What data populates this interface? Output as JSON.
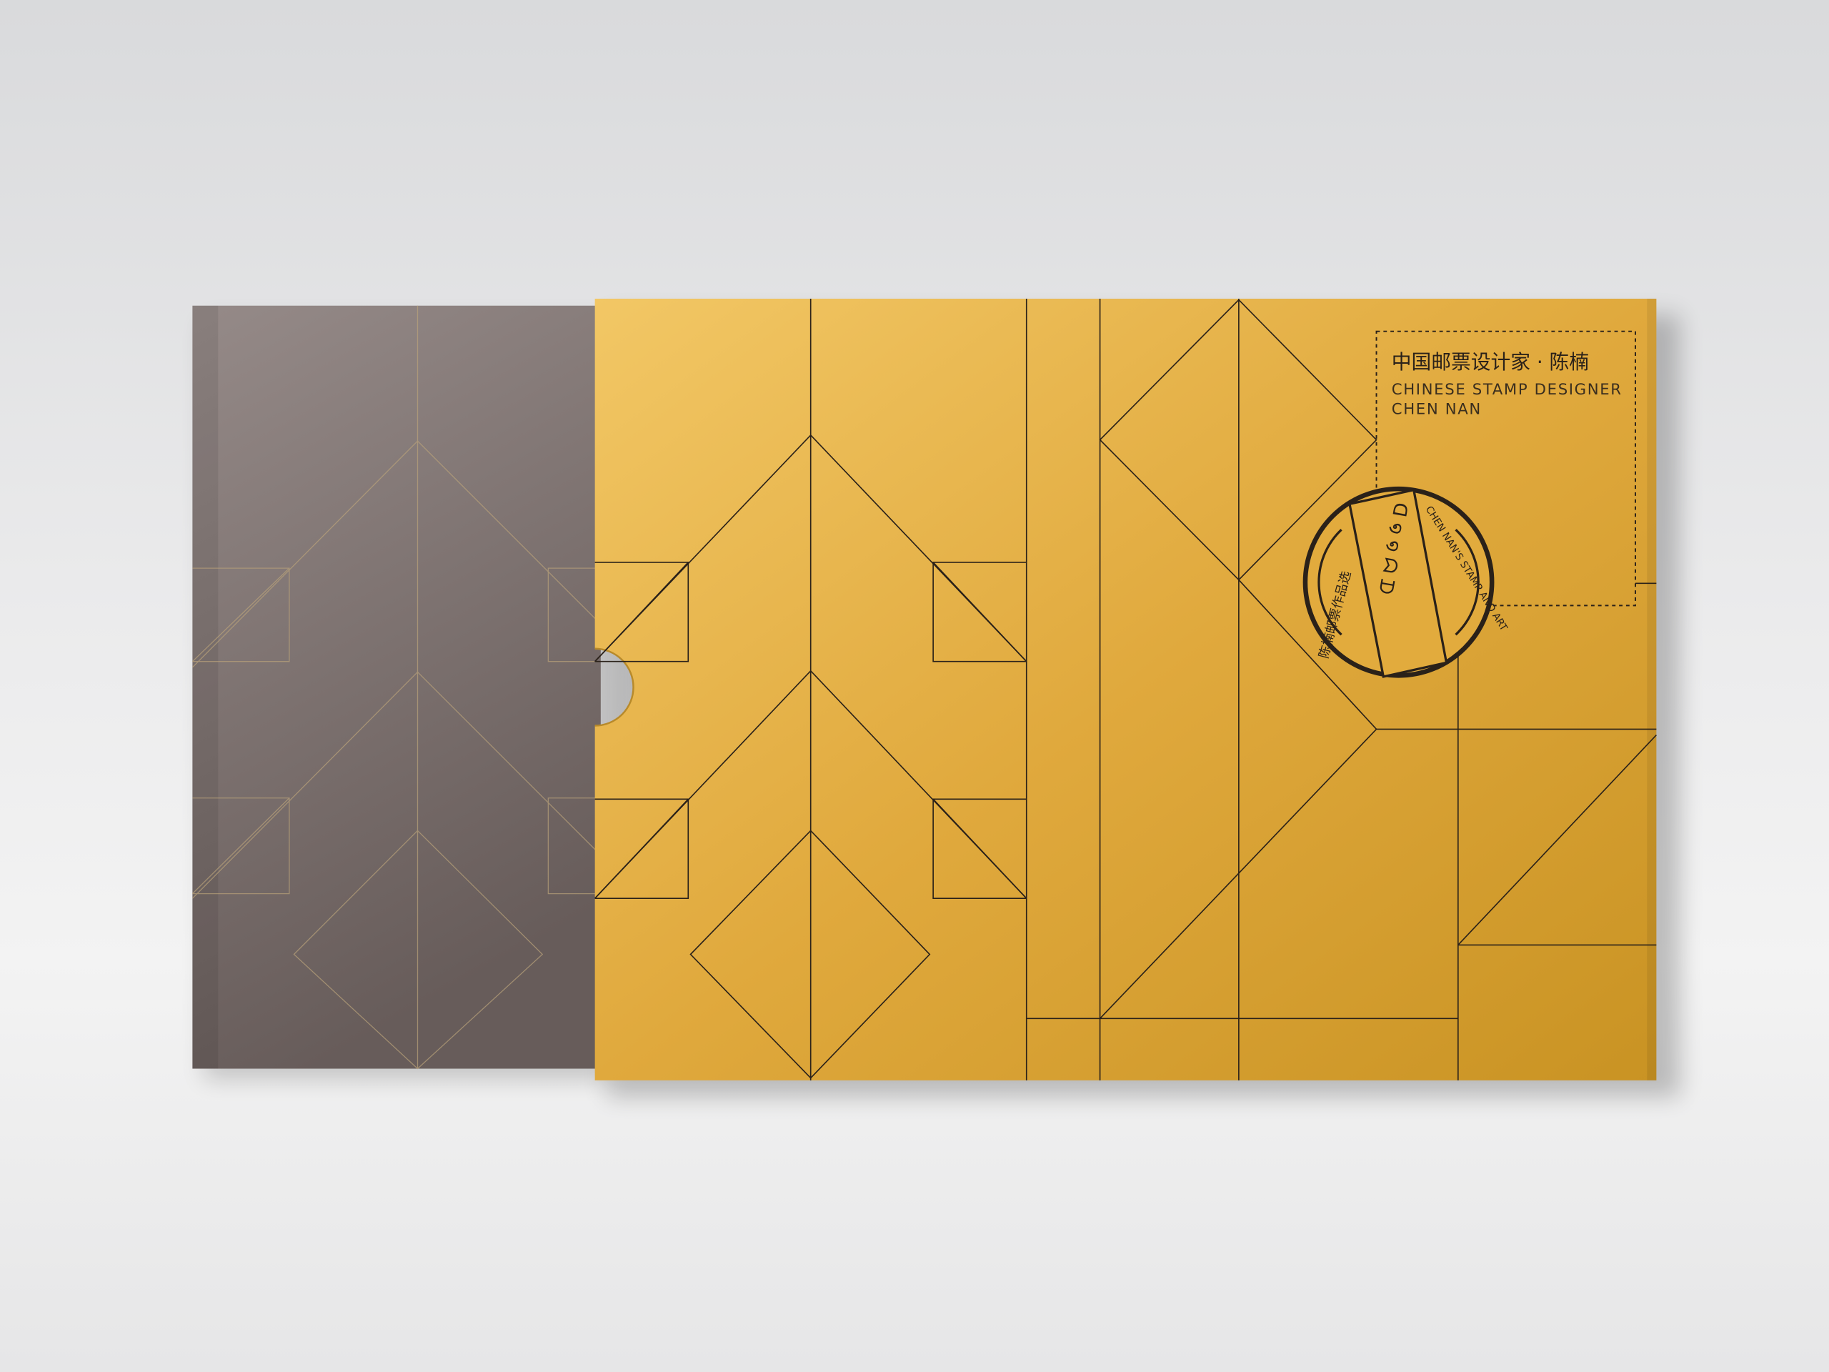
{
  "cover": {
    "title_cn": "中国邮票设计家 · 陈楠",
    "title_en_line1": "CHINESE STAMP DESIGNER",
    "title_en_line2": "CHEN NAN",
    "seal_left_text": "陈楠邮票作品选",
    "seal_right_text": "CHEN NAN'S STAMP AND ART"
  },
  "colors": {
    "slipcase": "#e0aa3c",
    "book": "#857a78",
    "line": "#2a2119"
  }
}
